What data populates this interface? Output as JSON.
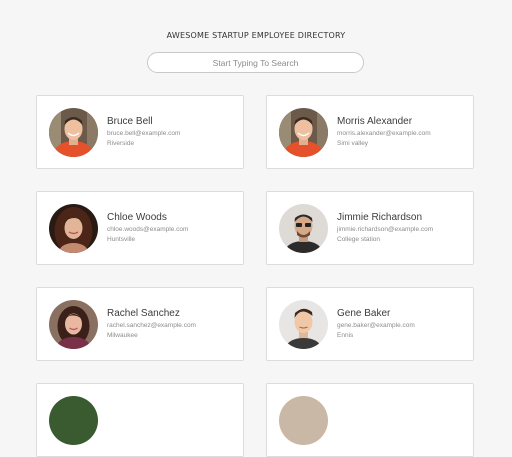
{
  "header": {
    "title": "AWESOME STARTUP EMPLOYEE DIRECTORY"
  },
  "search": {
    "placeholder": "Start Typing To Search",
    "value": ""
  },
  "employees": [
    {
      "name": "Bruce Bell",
      "email": "bruce.bell@example.com",
      "city": "Riverside"
    },
    {
      "name": "Morris Alexander",
      "email": "morris.alexander@example.com",
      "city": "Simi valley"
    },
    {
      "name": "Chloe Woods",
      "email": "chloe.woods@example.com",
      "city": "Huntsville"
    },
    {
      "name": "Jimmie Richardson",
      "email": "jimmie.richardson@example.com",
      "city": "College station"
    },
    {
      "name": "Rachel Sanchez",
      "email": "rachel.sanchez@example.com",
      "city": "Milwaukee"
    },
    {
      "name": "Gene Baker",
      "email": "gene.baker@example.com",
      "city": "Ennis"
    }
  ]
}
